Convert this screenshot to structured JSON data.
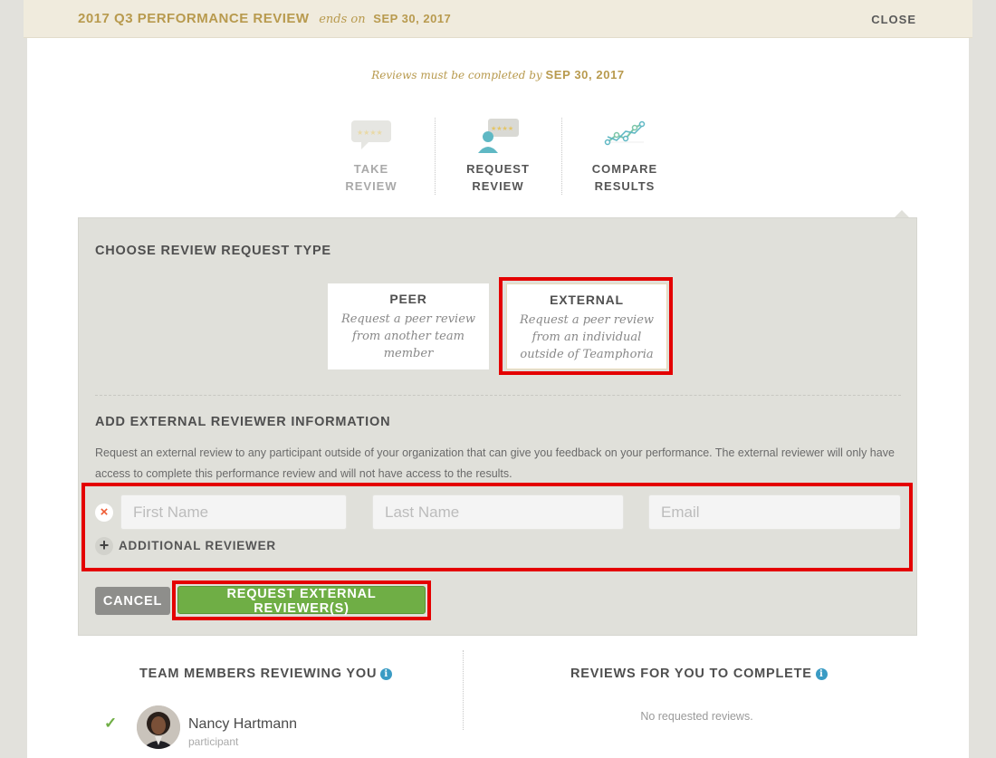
{
  "header": {
    "title": "2017 Q3 PERFORMANCE REVIEW",
    "ends_on": "ends on",
    "end_date": "SEP 30, 2017",
    "close_label": "CLOSE"
  },
  "deadline": {
    "text": "Reviews must be completed by",
    "date": "SEP 30, 2017"
  },
  "steps": [
    {
      "label": "TAKE\nREVIEW",
      "icon": "rating-bubble-icon",
      "active": false
    },
    {
      "label": "REQUEST\nREVIEW",
      "icon": "person-rating-icon",
      "active": true
    },
    {
      "label": "COMPARE\nRESULTS",
      "icon": "line-graph-icon",
      "active": false
    }
  ],
  "request_type": {
    "heading": "CHOOSE REVIEW REQUEST TYPE",
    "options": [
      {
        "title": "PEER",
        "description": "Request a peer review from another team member"
      },
      {
        "title": "EXTERNAL",
        "description": "Request a peer review from an individual outside of Teamphoria"
      }
    ],
    "selected": "EXTERNAL"
  },
  "external": {
    "heading": "ADD EXTERNAL REVIEWER INFORMATION",
    "description": "Request an external review to any participant outside of your organization that can give you feedback on your performance. The external reviewer will only have access to complete this performance review and will not have access to the results.",
    "first_name_placeholder": "First Name",
    "last_name_placeholder": "Last Name",
    "email_placeholder": "Email",
    "add_label": "ADDITIONAL REVIEWER"
  },
  "actions": {
    "cancel_label": "CANCEL",
    "request_label": "REQUEST EXTERNAL REVIEWER(S)"
  },
  "team_reviewing": {
    "heading": "TEAM MEMBERS REVIEWING YOU",
    "members": [
      {
        "name": "Nancy Hartmann",
        "role": "participant"
      }
    ]
  },
  "reviews_to_complete": {
    "heading": "REVIEWS FOR YOU TO COMPLETE",
    "empty": "No requested reviews."
  },
  "colors": {
    "gold": "#b89a4e",
    "green": "#6fae45",
    "highlight": "#e40000",
    "info": "#3a9bc4"
  }
}
